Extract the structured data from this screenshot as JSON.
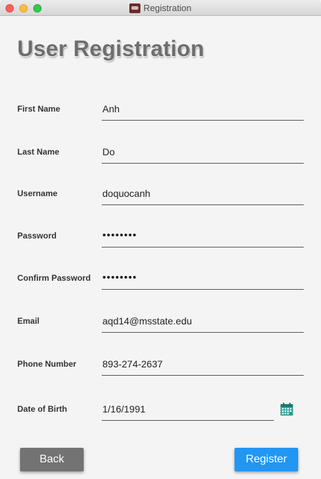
{
  "window": {
    "title": "Registration",
    "buttons": [
      "close",
      "minimize",
      "maximize"
    ]
  },
  "form": {
    "heading": "User Registration",
    "fields": [
      {
        "label": "First Name",
        "value": "Anh"
      },
      {
        "label": "Last Name",
        "value": "Do"
      },
      {
        "label": "Username",
        "value": "doquocanh"
      },
      {
        "label": "Password",
        "value": "••••••••"
      },
      {
        "label": "Confirm Password",
        "value": "••••••••"
      },
      {
        "label": "Email",
        "value": "aqd14@msstate.edu"
      },
      {
        "label": "Phone Number",
        "value": "893-274-2637"
      },
      {
        "label": "Date of Birth",
        "value": "1/16/1991",
        "icon": "calendar-icon"
      }
    ]
  },
  "actions": {
    "back_label": "Back",
    "register_label": "Register"
  },
  "colors": {
    "accent": "#2196f3",
    "secondary_button": "#737373",
    "background": "#f4f4f4"
  }
}
